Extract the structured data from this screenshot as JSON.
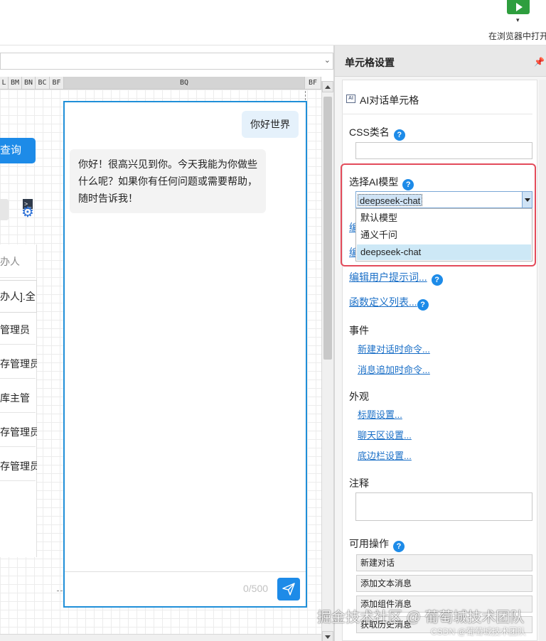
{
  "toolbar": {
    "run_label": "在浏览器中打开",
    "run_caret": "▾"
  },
  "designer": {
    "columns": [
      "L",
      "BM",
      "BN",
      "BC",
      "BF",
      "BQ",
      "BF"
    ],
    "left_button_label": "查询",
    "left_table": {
      "header": "办人",
      "rows": [
        "办人].全",
        "管理员",
        "存管理员",
        "库主管",
        "存管理员",
        "存管理员"
      ]
    },
    "chat": {
      "user_message": "你好世界",
      "ai_message": "你好！很高兴见到你。今天我能为你做些什么呢？如果你有任何问题或需要帮助，随时告诉我！",
      "char_count": "0/500"
    }
  },
  "panel": {
    "title": "单元格设置",
    "cell_type": "AI对话单元格",
    "ai_icon_text": "AI",
    "css_label": "CSS类名",
    "css_value": "",
    "model_label": "选择AI模型",
    "model_selected": "deepseek-chat",
    "model_options": [
      "默认模型",
      "通义千问",
      "deepseek-chat"
    ],
    "model_peek_1": "编",
    "model_peek_2": "编",
    "edit_user_prompt": "编辑用户提示词...",
    "function_list": "函数定义列表...",
    "events_label": "事件",
    "event_links": [
      "新建对话时命令...",
      "消息追加时命令..."
    ],
    "appearance_label": "外观",
    "appearance_links": [
      "标题设置...",
      "聊天区设置...",
      "底边栏设置..."
    ],
    "notes_label": "注释",
    "notes_value": "",
    "ops_label": "可用操作",
    "ops": [
      "新建对话",
      "添加文本消息",
      "添加组件消息",
      "获取历史消息"
    ]
  },
  "watermark": {
    "main": "掘金技术社区 @ 葡萄城技术团队",
    "small": "CSDN @葡萄城技术团队"
  },
  "colors": {
    "accent": "#1d8be8",
    "highlight": "#e34b5a",
    "link": "#1a6fc7",
    "run_green": "#2e9e3e"
  }
}
